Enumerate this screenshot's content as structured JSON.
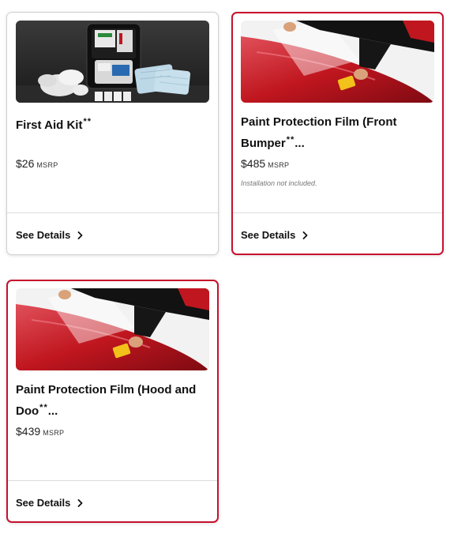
{
  "products": [
    {
      "title": "First Aid Kit",
      "marks": "**",
      "price": "$26",
      "price_unit": "MSRP",
      "note": "",
      "details_label": "See Details",
      "image": "first-aid-kit-photo",
      "selected": false
    },
    {
      "title": "Paint Protection Film (Front Bumper",
      "marks": "**",
      "ellipsis": "...",
      "price": "$485",
      "price_unit": "MSRP",
      "note": "Installation not included.",
      "details_label": "See Details",
      "image": "paint-protection-film-photo",
      "selected": true
    },
    {
      "title": "Paint Protection Film (Hood and Doo",
      "marks": "**",
      "ellipsis": "...",
      "price": "$439",
      "price_unit": "MSRP",
      "note": "",
      "details_label": "See Details",
      "image": "paint-protection-film-photo",
      "selected": true
    }
  ],
  "colors": {
    "selected_border": "#c8102e",
    "car_red": "#c0161f",
    "text": "#111111"
  },
  "icons": {
    "details_chevron": "chevron-right-icon"
  }
}
